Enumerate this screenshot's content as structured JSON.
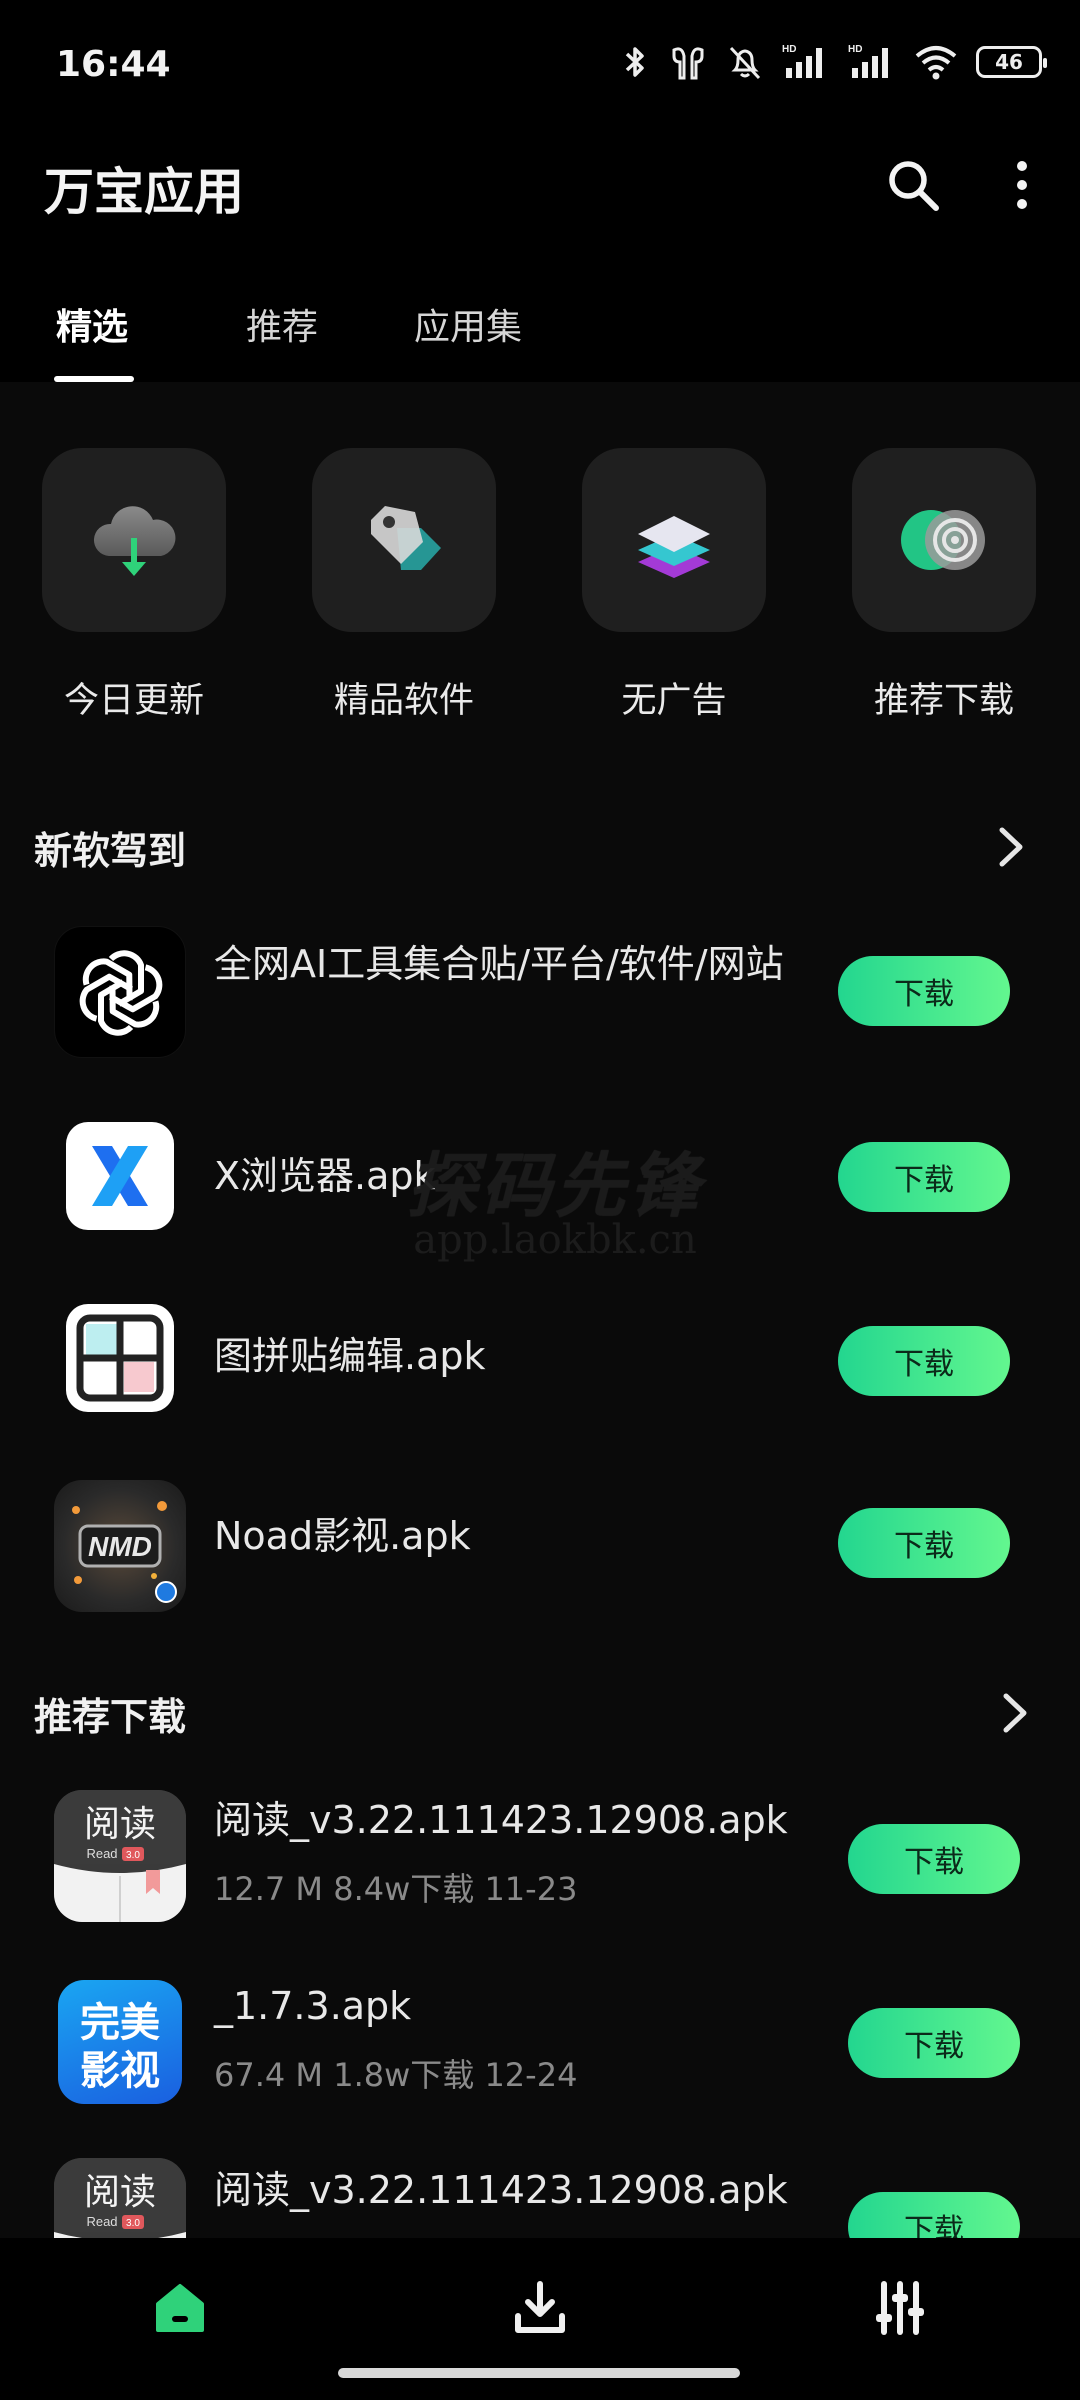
{
  "status_bar": {
    "time": "16:44",
    "battery_level": "46"
  },
  "app_bar": {
    "title": "万宝应用"
  },
  "tabs": [
    {
      "label": "精选",
      "active": true
    },
    {
      "label": "推荐",
      "active": false
    },
    {
      "label": "应用集",
      "active": false
    }
  ],
  "categories": [
    {
      "label": "今日更新",
      "icon": "cloud-download-icon"
    },
    {
      "label": "精品软件",
      "icon": "tag-icon"
    },
    {
      "label": "无广告",
      "icon": "layers-icon"
    },
    {
      "label": "推荐下载",
      "icon": "target-icon"
    }
  ],
  "sections": [
    {
      "title": "新软驾到",
      "items": [
        {
          "name": "全网AI工具集合贴/平台/软件/网站",
          "button": "下载"
        },
        {
          "name": "X浏览器.apk",
          "button": "下载"
        },
        {
          "name": "图拼贴编辑.apk",
          "button": "下载"
        },
        {
          "name": "Noad影视.apk",
          "button": "下载"
        }
      ]
    },
    {
      "title": "推荐下载",
      "items": [
        {
          "name": "阅读_v3.22.111423.12908.apk",
          "meta": "12.7 M   8.4w下载   11-23",
          "button": "下载"
        },
        {
          "name": "_1.7.3.apk",
          "meta": "67.4 M   1.8w下载   12-24",
          "button": "下载"
        },
        {
          "name": "阅读_v3.22.111423.12908.apk",
          "button": "下载"
        }
      ]
    }
  ],
  "icon_labels": {
    "read_app": "阅读",
    "read_app_sub": "Read",
    "read_app_version": "3.0",
    "wanmei_line1": "完美",
    "wanmei_line2": "影视",
    "noad_logo": "NMD"
  },
  "watermark": {
    "main": "探码先锋",
    "sub": "app.laokbk.cn"
  },
  "colors": {
    "accent": "#23d68f",
    "background": "#0a0a0a",
    "button_text": "#0b2a1a"
  }
}
